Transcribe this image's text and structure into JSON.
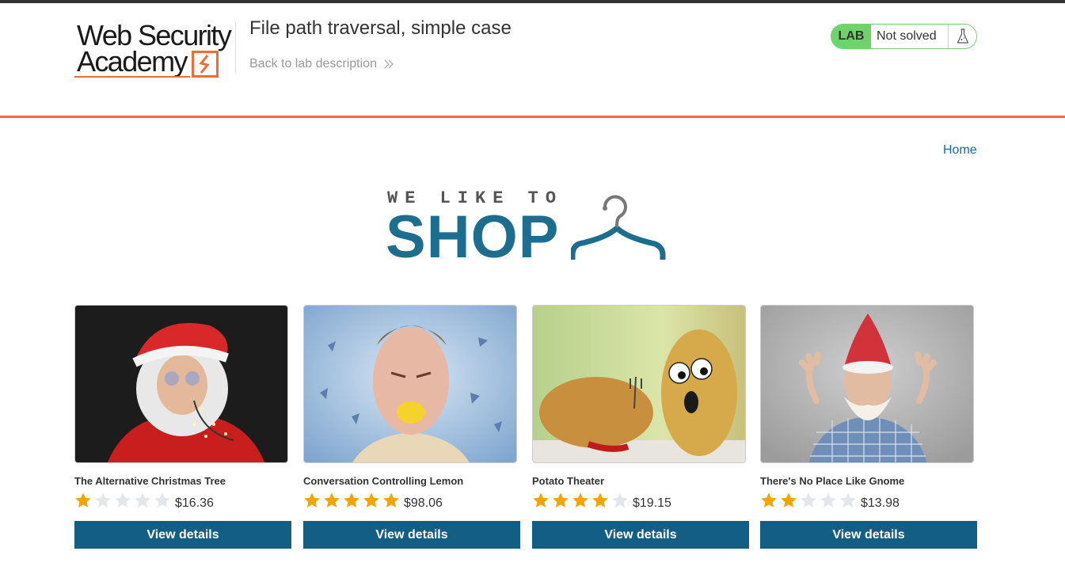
{
  "header": {
    "logo": {
      "line1": "Web Security",
      "line2": "Academy"
    },
    "lab_title": "File path traversal, simple case",
    "back_link": "Back to lab description",
    "lab_status": {
      "badge": "LAB",
      "state": "Not solved"
    }
  },
  "nav": {
    "home": "Home"
  },
  "banner": {
    "line1": "WE LIKE TO",
    "line2": "SHOP"
  },
  "colors": {
    "accent_orange": "#f06c37",
    "lab_green": "#70d16d",
    "button_blue": "#135e84",
    "link_blue": "#0f6daa",
    "banner_blue": "#1d6e8e"
  },
  "products": [
    {
      "name": "The Alternative Christmas Tree",
      "rating": 1,
      "price": "$16.36",
      "button": "View details"
    },
    {
      "name": "Conversation Controlling Lemon",
      "rating": 5,
      "price": "$98.06",
      "button": "View details"
    },
    {
      "name": "Potato Theater",
      "rating": 4,
      "price": "$19.15",
      "button": "View details"
    },
    {
      "name": "There's No Place Like Gnome",
      "rating": 2,
      "price": "$13.98",
      "button": "View details"
    }
  ]
}
